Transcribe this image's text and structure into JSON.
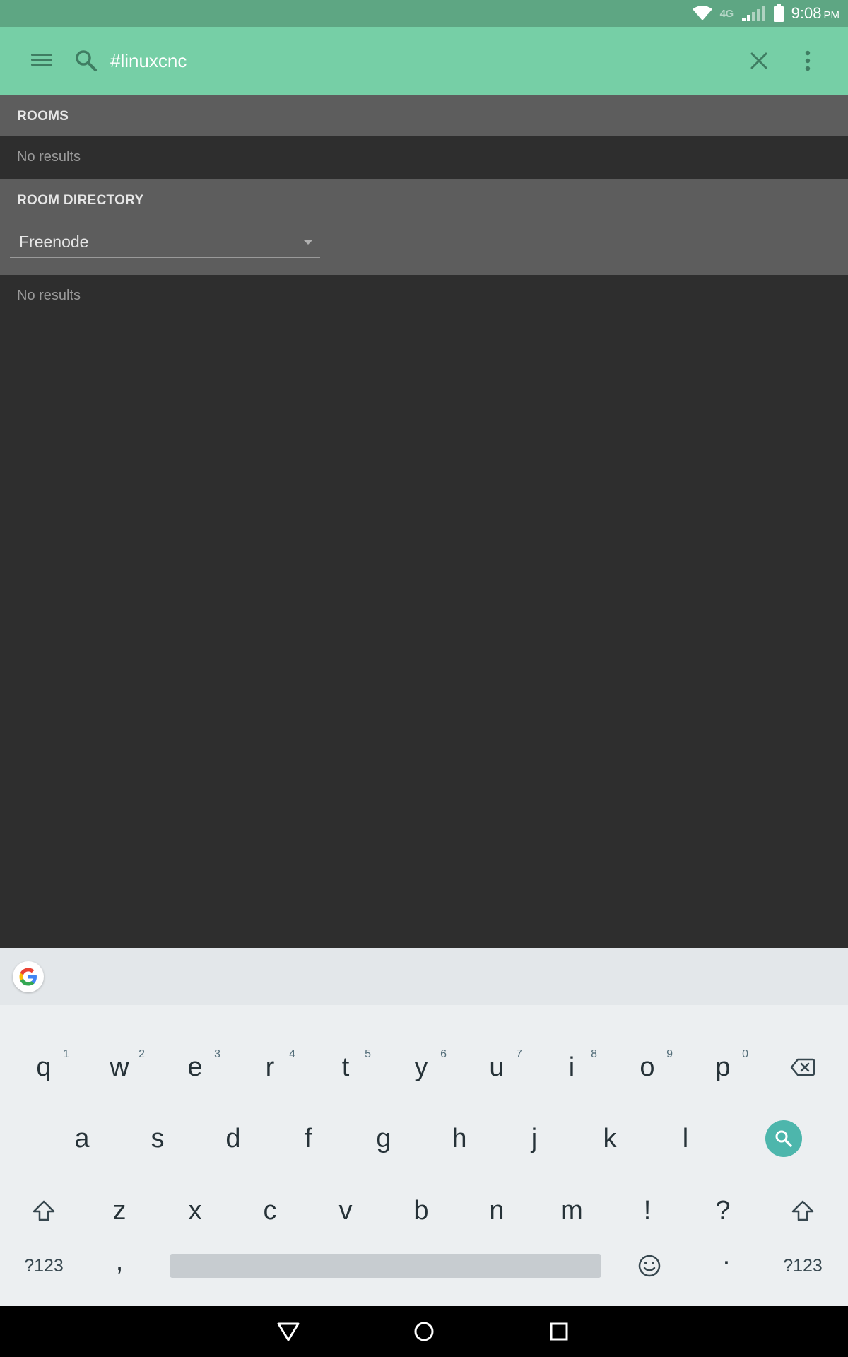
{
  "status_bar": {
    "network_label": "4G",
    "time": "9:08",
    "ampm": "PM",
    "icons": [
      "wifi-icon",
      "signal-icon",
      "battery-icon"
    ]
  },
  "toolbar": {
    "search_value": "#linuxcnc",
    "icons": [
      "menu-icon",
      "search-icon",
      "close-icon",
      "more-vert-icon"
    ],
    "accent_color": "#76cfa6"
  },
  "rooms": {
    "title": "ROOMS",
    "empty_text": "No results"
  },
  "room_directory": {
    "title": "ROOM DIRECTORY",
    "selected_server": "Freenode",
    "empty_text": "No results"
  },
  "keyboard": {
    "row1": [
      {
        "key": "q",
        "hint": "1"
      },
      {
        "key": "w",
        "hint": "2"
      },
      {
        "key": "e",
        "hint": "3"
      },
      {
        "key": "r",
        "hint": "4"
      },
      {
        "key": "t",
        "hint": "5"
      },
      {
        "key": "y",
        "hint": "6"
      },
      {
        "key": "u",
        "hint": "7"
      },
      {
        "key": "i",
        "hint": "8"
      },
      {
        "key": "o",
        "hint": "9"
      },
      {
        "key": "p",
        "hint": "0"
      }
    ],
    "row2": [
      "a",
      "s",
      "d",
      "f",
      "g",
      "h",
      "j",
      "k",
      "l"
    ],
    "row3": [
      "z",
      "x",
      "c",
      "v",
      "b",
      "n",
      "m",
      "!",
      "?"
    ],
    "symbols_label": "?123",
    "comma": ",",
    "period": "·",
    "icons": [
      "backspace-icon",
      "search-key-icon",
      "shift-icon",
      "emoji-icon",
      "google-icon"
    ]
  },
  "nav": {
    "icons": [
      "back-icon",
      "home-icon",
      "recents-icon"
    ]
  }
}
